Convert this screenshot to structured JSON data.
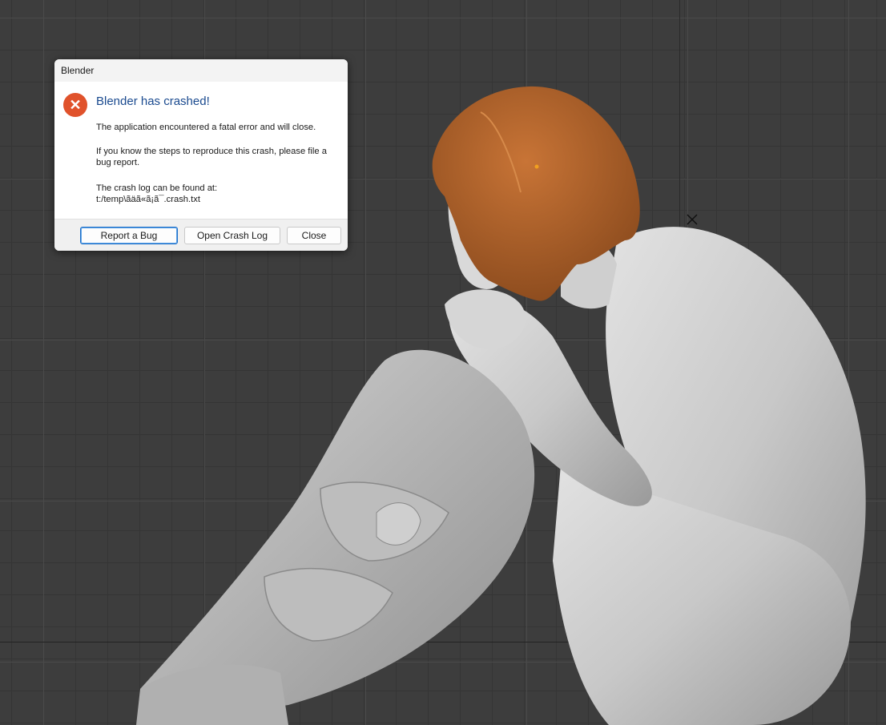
{
  "dialog": {
    "window_title": "Blender",
    "icon": "error-icon",
    "heading": "Blender has crashed!",
    "message_1": "The application encountered a fatal error and will close.",
    "message_2": "If you know the steps to reproduce this crash, please file a bug report.",
    "message_3_line1": "The crash log can be found at:",
    "message_3_line2": "t:/temp\\ãäã«ã¡ã¯.crash.txt",
    "buttons": {
      "report": "Report a Bug",
      "open_log": "Open Crash Log",
      "close": "Close"
    }
  },
  "colors": {
    "viewport_bg": "#3d3d3d",
    "heading": "#1a4a8f",
    "error_icon": "#e0522b",
    "hair": "#b5652a",
    "mesh": "#c9c9c9"
  }
}
